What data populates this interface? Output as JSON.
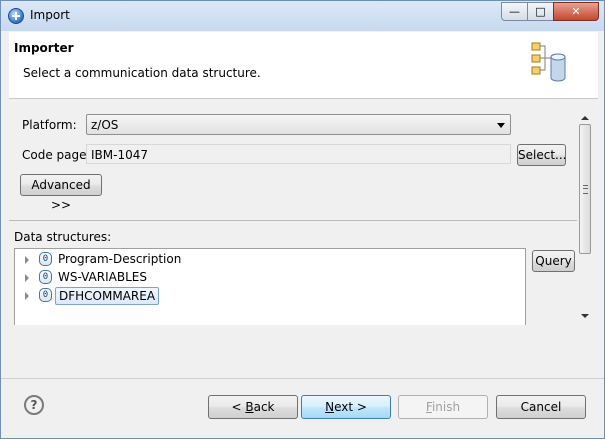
{
  "window": {
    "title": "Import",
    "controls": [
      "minimize",
      "maximize",
      "close"
    ]
  },
  "header": {
    "title": "Importer",
    "description": "Select a communication data structure."
  },
  "form": {
    "platform_label": "Platform:",
    "platform_value": "z/OS",
    "codepage_label": "Code page:",
    "codepage_value": "IBM-1047",
    "select_button": "Select...",
    "advanced_button": "Advanced >>"
  },
  "data_structures": {
    "label": "Data structures:",
    "query_button": "Query",
    "items": [
      {
        "label": "Program-Description",
        "icon": "data-structure-icon",
        "selected": false
      },
      {
        "label": "WS-VARIABLES",
        "icon": "data-structure-icon",
        "selected": false
      },
      {
        "label": "DFHCOMMAREA",
        "icon": "data-structure-icon",
        "selected": true
      }
    ]
  },
  "footer": {
    "help_icon": "?",
    "back_prefix": "< ",
    "back_mnemonic": "B",
    "back_rest": "ack",
    "next_mnemonic": "N",
    "next_rest": "ext >",
    "finish_mnemonic": "F",
    "finish_rest": "inish",
    "cancel_label": "Cancel"
  }
}
